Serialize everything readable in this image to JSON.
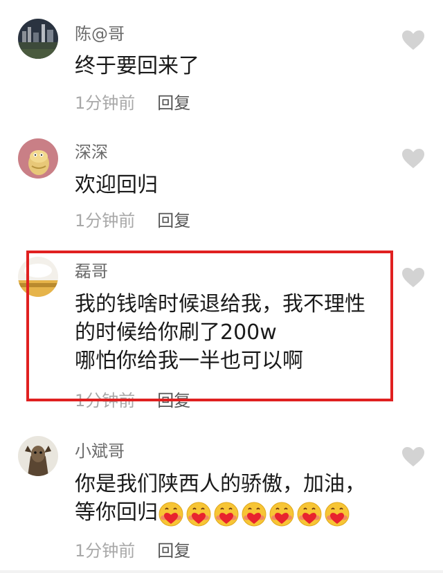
{
  "comments": [
    {
      "username": "陈@哥",
      "lines": [
        "终于要回来了"
      ],
      "time": "1分钟前",
      "reply": "回复"
    },
    {
      "username": "深深",
      "lines": [
        "欢迎回归"
      ],
      "time": "1分钟前",
      "reply": "回复"
    },
    {
      "username": "磊哥",
      "lines": [
        "我的钱啥时候退给我，我不理性",
        "的时候给你刷了200w",
        "哪怕你给我一半也可以啊"
      ],
      "time": "1分钟前",
      "reply": "回复"
    },
    {
      "username": "小斌哥",
      "lines": [
        "你是我们陕西人的骄傲，加油，",
        "等你回归"
      ],
      "time": "1分钟前",
      "reply": "回复"
    }
  ],
  "emoji_count": 7,
  "icons": {
    "like": "heart-icon",
    "emoji": "heart-eyes-blush-emoji"
  },
  "colors": {
    "highlight": "#e02020",
    "heart": "#d3d3d3",
    "username": "#6b6b6b",
    "time": "#a8a8a8"
  }
}
